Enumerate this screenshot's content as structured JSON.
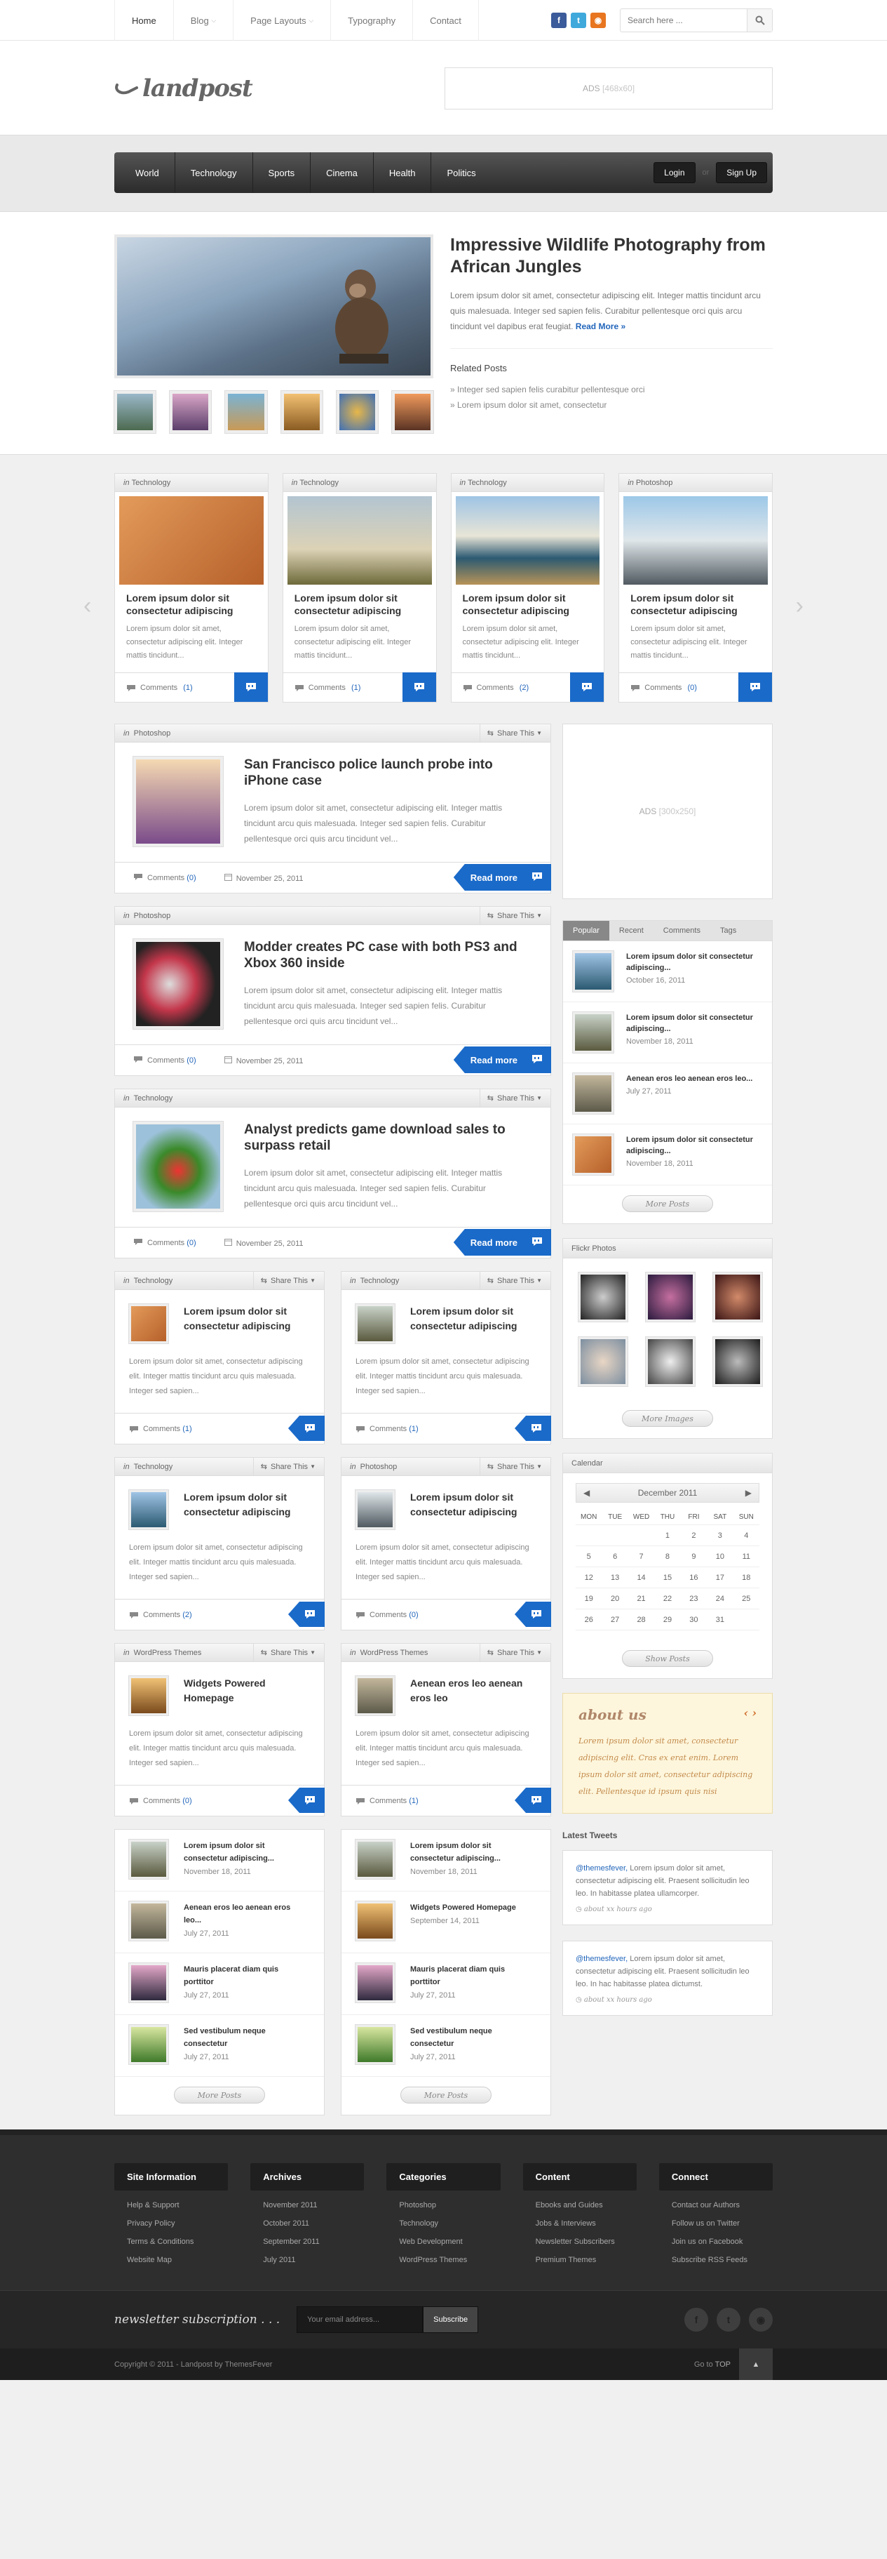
{
  "topnav": [
    "Home",
    "Blog",
    "Page Layouts",
    "Typography",
    "Contact"
  ],
  "search": {
    "placeholder": "Search here ..."
  },
  "logo": "landpost",
  "ads_top": {
    "label": "ADS",
    "size": "[468x60]"
  },
  "mainnav": {
    "items": [
      "World",
      "Technology",
      "Sports",
      "Cinema",
      "Health",
      "Politics"
    ],
    "login": "Login",
    "or": "or",
    "signup": "Sign Up"
  },
  "featured": {
    "title": "Impressive Wildlife Photography from African Jungles",
    "text": "Lorem ipsum dolor sit amet, consectetur adipiscing elit. Integer mattis tincidunt arcu quis malesuada. Integer sed sapien felis. Curabitur pellentesque orci quis arcu tincidunt vel dapibus erat feugiat.",
    "more": "Read More »",
    "related_title": "Related Posts",
    "related": [
      "» Integer sed sapien felis curabitur pellentesque orci",
      "» Lorem ipsum dolor sit amet, consectetur"
    ]
  },
  "cards": [
    {
      "cat": "Technology",
      "title": "Lorem ipsum dolor sit consectetur adipiscing",
      "text": "Lorem ipsum dolor sit amet, consectetur adipiscing elit. Integer mattis tincidunt...",
      "comments": "Comments",
      "count": "(1)"
    },
    {
      "cat": "Technology",
      "title": "Lorem ipsum dolor sit consectetur adipiscing",
      "text": "Lorem ipsum dolor sit amet, consectetur adipiscing elit. Integer mattis tincidunt...",
      "comments": "Comments",
      "count": "(1)"
    },
    {
      "cat": "Technology",
      "title": "Lorem ipsum dolor sit consectetur adipiscing",
      "text": "Lorem ipsum dolor sit amet, consectetur adipiscing elit. Integer mattis tincidunt...",
      "comments": "Comments",
      "count": "(2)"
    },
    {
      "cat": "Photoshop",
      "title": "Lorem ipsum dolor sit consectetur adipiscing",
      "text": "Lorem ipsum dolor sit amet, consectetur adipiscing elit. Integer mattis tincidunt...",
      "comments": "Comments",
      "count": "(0)"
    }
  ],
  "in": "in",
  "share": "Share This",
  "readmore": "Read more",
  "posts": [
    {
      "cat": "Photoshop",
      "title": "San Francisco police launch probe into iPhone case",
      "text": "Lorem ipsum dolor sit amet, consectetur adipiscing elit. Integer mattis tincidunt arcu quis malesuada. Integer sed sapien felis. Curabitur pellentesque orci quis arcu tincidunt vel...",
      "comments": "Comments",
      "count": "(0)",
      "date": "November 25, 2011"
    },
    {
      "cat": "Photoshop",
      "title": "Modder creates PC case with both PS3 and Xbox 360 inside",
      "text": "Lorem ipsum dolor sit amet, consectetur adipiscing elit. Integer mattis tincidunt arcu quis malesuada. Integer sed sapien felis. Curabitur pellentesque orci quis arcu tincidunt vel...",
      "comments": "Comments",
      "count": "(0)",
      "date": "November 25, 2011"
    },
    {
      "cat": "Technology",
      "title": "Analyst predicts game download sales to surpass retail",
      "text": "Lorem ipsum dolor sit amet, consectetur adipiscing elit. Integer mattis tincidunt arcu quis malesuada. Integer sed sapien felis. Curabitur pellentesque orci quis arcu tincidunt vel...",
      "comments": "Comments",
      "count": "(0)",
      "date": "November 25, 2011"
    }
  ],
  "halfposts": [
    {
      "cat": "Technology",
      "title": "Lorem ipsum dolor sit consectetur adipiscing",
      "text": "Lorem ipsum dolor sit amet, consectetur adipiscing elit. Integer mattis tincidunt arcu quis malesuada. Integer sed sapien...",
      "count": "(1)"
    },
    {
      "cat": "Technology",
      "title": "Lorem ipsum dolor sit consectetur adipiscing",
      "text": "Lorem ipsum dolor sit amet, consectetur adipiscing elit. Integer mattis tincidunt arcu quis malesuada. Integer sed sapien...",
      "count": "(1)"
    },
    {
      "cat": "Technology",
      "title": "Lorem ipsum dolor sit consectetur adipiscing",
      "text": "Lorem ipsum dolor sit amet, consectetur adipiscing elit. Integer mattis tincidunt arcu quis malesuada. Integer sed sapien...",
      "count": "(2)"
    },
    {
      "cat": "Photoshop",
      "title": "Lorem ipsum dolor sit consectetur adipiscing",
      "text": "Lorem ipsum dolor sit amet, consectetur adipiscing elit. Integer mattis tincidunt arcu quis malesuada. Integer sed sapien...",
      "count": "(0)"
    },
    {
      "cat": "WordPress Themes",
      "title": "Widgets Powered Homepage",
      "text": "Lorem ipsum dolor sit amet, consectetur adipiscing elit. Integer mattis tincidunt arcu quis malesuada. Integer sed sapien...",
      "count": "(0)"
    },
    {
      "cat": "WordPress Themes",
      "title": "Aenean eros leo aenean eros leo",
      "text": "Lorem ipsum dolor sit amet, consectetur adipiscing elit. Integer mattis tincidunt arcu quis malesuada. Integer sed sapien...",
      "count": "(1)"
    }
  ],
  "listleft": [
    {
      "title": "Lorem ipsum dolor sit consectetur adipiscing...",
      "date": "November 18, 2011"
    },
    {
      "title": "Aenean eros leo aenean eros leo...",
      "date": "July 27, 2011"
    },
    {
      "title": "Mauris placerat diam quis porttitor",
      "date": "July 27, 2011"
    },
    {
      "title": "Sed vestibulum neque consectetur",
      "date": "July 27, 2011"
    }
  ],
  "listright": [
    {
      "title": "Lorem ipsum dolor sit consectetur adipiscing...",
      "date": "November 18, 2011"
    },
    {
      "title": "Widgets Powered Homepage",
      "date": "September 14, 2011"
    },
    {
      "title": "Mauris placerat diam quis porttitor",
      "date": "July 27, 2011"
    },
    {
      "title": "Sed vestibulum neque consectetur",
      "date": "July 27, 2011"
    }
  ],
  "moreposts": "More Posts",
  "ads_side": {
    "label": "ADS",
    "size": "[300x250]"
  },
  "tabs": [
    "Popular",
    "Recent",
    "Comments",
    "Tags"
  ],
  "popular": [
    {
      "title": "Lorem ipsum dolor sit consectetur adipiscing...",
      "date": "October 16, 2011"
    },
    {
      "title": "Lorem ipsum dolor sit consectetur adipiscing...",
      "date": "November 18, 2011"
    },
    {
      "title": "Aenean eros leo aenean eros leo...",
      "date": "July 27, 2011"
    },
    {
      "title": "Lorem ipsum dolor sit consectetur adipiscing...",
      "date": "November 18, 2011"
    }
  ],
  "flickr_title": "Flickr Photos",
  "moreimages": "More Images",
  "calendar": {
    "title": "Calendar",
    "month": "December 2011",
    "days": [
      "MON",
      "TUE",
      "WED",
      "THU",
      "FRI",
      "SAT",
      "SUN"
    ],
    "cells": [
      "",
      "",
      "",
      "1",
      "2",
      "3",
      "4",
      "5",
      "6",
      "7",
      "8",
      "9",
      "10",
      "11",
      "12",
      "13",
      "14",
      "15",
      "16",
      "17",
      "18",
      "19",
      "20",
      "21",
      "22",
      "23",
      "24",
      "25",
      "26",
      "27",
      "28",
      "29",
      "30",
      "31",
      ""
    ]
  },
  "showposts": "Show Posts",
  "about": {
    "title": "about us",
    "text": "Lorem ipsum dolor sit amet, consectetur adipiscing elit. Cras ex erat enim. Lorem ipsum dolor sit amet, consectetur adipiscing elit. Pellentesque id ipsum quis nisi"
  },
  "tweets_title": "Latest Tweets",
  "tweets": [
    {
      "user": "@themesfever,",
      "text": " Lorem ipsum dolor sit amet, consectetur adipiscing elit. Praesent sollicitudin leo leo. In habitasse platea ullamcorper.",
      "ago": "about xx hours ago"
    },
    {
      "user": "@themesfever,",
      "text": " Lorem ipsum dolor sit amet, consectetur adipiscing elit. Praesent sollicitudin leo leo. In hac habitasse platea dictumst.",
      "ago": "about xx hours ago"
    }
  ],
  "footer": [
    {
      "title": "Site Information",
      "items": [
        "Help & Support",
        "Privacy Policy",
        "Terms & Conditions",
        "Website Map"
      ]
    },
    {
      "title": "Archives",
      "items": [
        "November 2011",
        "October 2011",
        "September 2011",
        "July 2011"
      ]
    },
    {
      "title": "Categories",
      "items": [
        "Photoshop",
        "Technology",
        "Web Development",
        "WordPress Themes"
      ]
    },
    {
      "title": "Content",
      "items": [
        "Ebooks and Guides",
        "Jobs & Interviews",
        "Newsletter Subscribers",
        "Premium Themes"
      ]
    },
    {
      "title": "Connect",
      "items": [
        "Contact our Authors",
        "Follow us on Twitter",
        "Join us on Facebook",
        "Subscribe RSS Feeds"
      ]
    }
  ],
  "newsletter": {
    "label": "newsletter subscription . . .",
    "placeholder": "Your email address...",
    "button": "Subscribe"
  },
  "copyright": "Copyright © 2011 - Landpost by ThemesFever",
  "goto": "Go to",
  "top": "TOP",
  "colors": {
    "accent": "#1a6ac9",
    "dark": "#2e2e2e"
  }
}
